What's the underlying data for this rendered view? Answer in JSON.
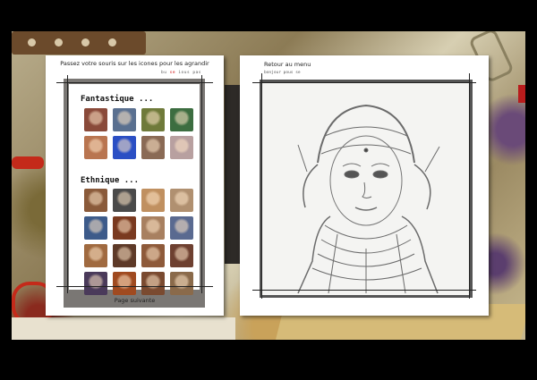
{
  "left_panel": {
    "hint": "Passez votre souris sur les icones pour les agrandir",
    "credit_dark": "bu",
    "credit_light": "ious pas",
    "credit_red": "se",
    "categories": [
      {
        "title": "Fantastique ...",
        "thumbs": [
          "#8a4a3a",
          "#5a7090",
          "#6f7a3a",
          "#3c6d40",
          "#b97550",
          "#2b4fc4",
          "#8a6a55",
          "#b8a0a0"
        ]
      },
      {
        "title": "Ethnique ...",
        "thumbs": [
          "#8a5a3a",
          "#4a4a4a",
          "#c09060",
          "#b09070",
          "#3d5b8a",
          "#7a3a20",
          "#a88060",
          "#5a6a90",
          "#a06a40",
          "#5e3a28",
          "#8e5a3a",
          "#6e4030",
          "#4a3a5a",
          "#a04a20",
          "#7a4a30",
          "#8a6a4a"
        ]
      }
    ],
    "next_label": "Page suivante"
  },
  "right_panel": {
    "back_label": "Retour au menu",
    "credit": "bonjour pous  se"
  },
  "colors": {
    "frame": "#7a7774",
    "accent_red": "#cc0000"
  }
}
